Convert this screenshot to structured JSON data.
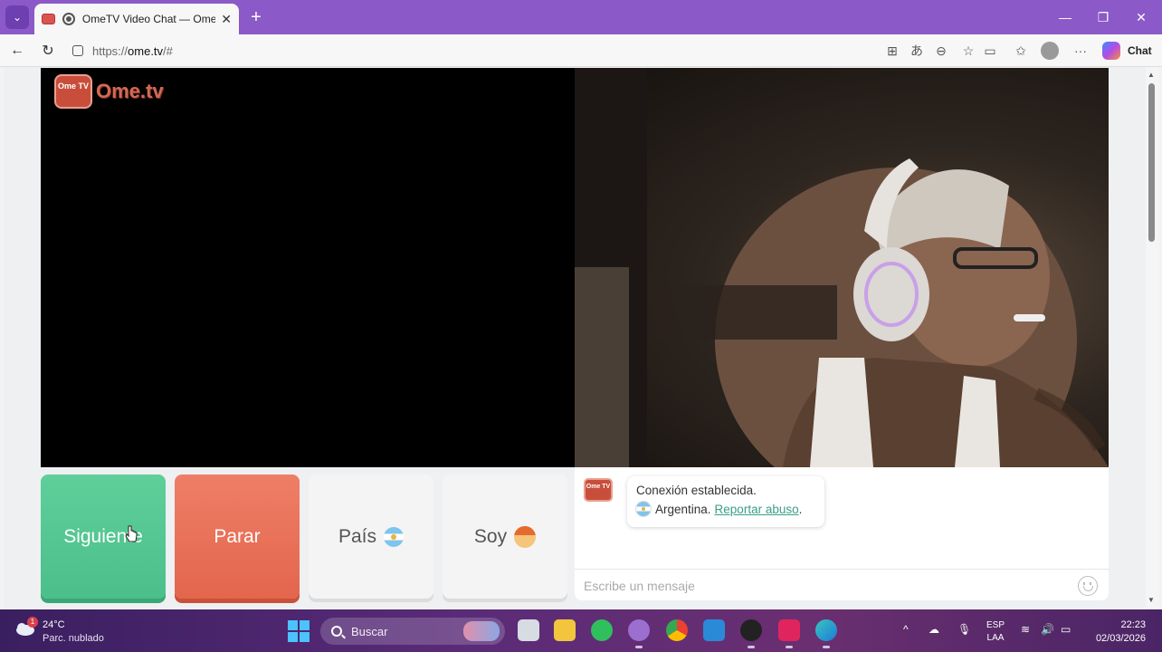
{
  "browser": {
    "tab_title": "OmeTV Video Chat — Omegle",
    "url_prefix": "https://",
    "url_host": "ome.tv",
    "url_suffix": "/#",
    "chat_label": "Chat"
  },
  "page": {
    "logo_badge": "Ome TV",
    "logo_text": "Ome.tv",
    "buttons": {
      "next": "Siguiente",
      "stop": "Parar",
      "country": "País",
      "gender": "Soy"
    },
    "chat": {
      "logo_badge": "Ome TV",
      "status": "Conexión establecida.",
      "country": "Argentina.",
      "report_link": "Reportar abuso",
      "report_suffix": ".",
      "input_placeholder": "Escribe un mensaje"
    }
  },
  "taskbar": {
    "weather_badge": "1",
    "temperature": "24°C",
    "condition": "Parc. nublado",
    "search_label": "Buscar",
    "lang_line1": "ESP",
    "lang_line2": "LAA",
    "time": "22:23",
    "date": "02/03/2026"
  },
  "colors": {
    "next_button": "#4bbf8a",
    "stop_button": "#e3664d",
    "report_link": "#3a9e86",
    "browser_frame": "#8b59c8"
  }
}
